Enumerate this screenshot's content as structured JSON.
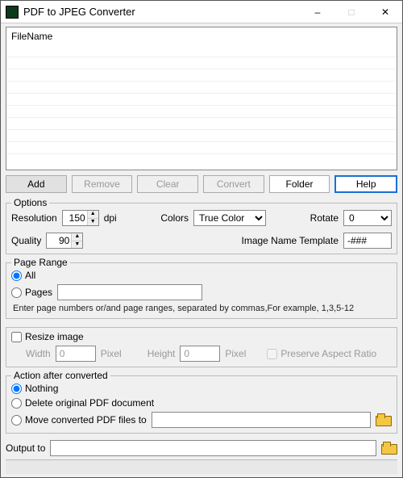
{
  "window": {
    "title": "PDF to JPEG Converter"
  },
  "filelist": {
    "header": "FileName"
  },
  "buttons": {
    "add": "Add",
    "remove": "Remove",
    "clear": "Clear",
    "convert": "Convert",
    "folder": "Folder",
    "help": "Help"
  },
  "options": {
    "legend": "Options",
    "resolution_label": "Resolution",
    "resolution_value": "150",
    "resolution_unit": "dpi",
    "colors_label": "Colors",
    "colors_value": "True Color",
    "rotate_label": "Rotate",
    "rotate_value": "0",
    "quality_label": "Quality",
    "quality_value": "90",
    "template_label": "Image Name Template",
    "template_value": "-###"
  },
  "pagerange": {
    "legend": "Page Range",
    "all": "All",
    "pages": "Pages",
    "pages_value": "",
    "hint": "Enter page numbers or/and page ranges, separated by commas,For example, 1,3,5-12"
  },
  "resize": {
    "label": "Resize image",
    "width_label": "Width",
    "width_value": "0",
    "height_label": "Height",
    "height_value": "0",
    "pixel": "Pixel",
    "preserve": "Preserve Aspect Ratio"
  },
  "action": {
    "legend": "Action after converted",
    "nothing": "Nothing",
    "delete": "Delete original PDF document",
    "move": "Move converted PDF files to",
    "move_path": ""
  },
  "output": {
    "label": "Output to",
    "value": ""
  }
}
